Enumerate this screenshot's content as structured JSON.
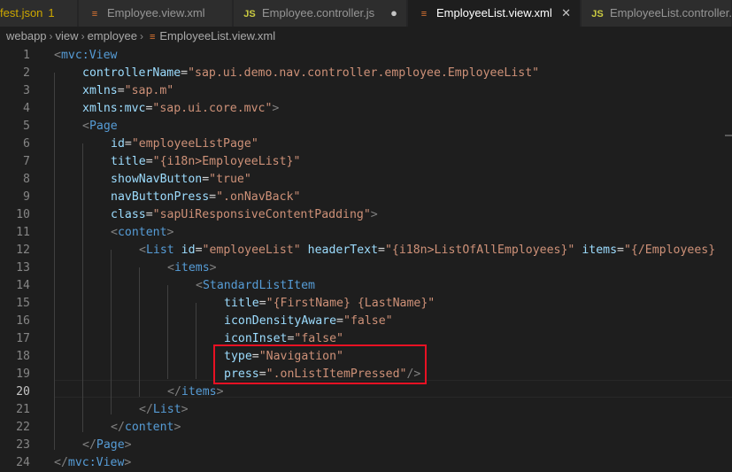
{
  "tabs": [
    {
      "label": "fest.json",
      "badge": "1",
      "icon": "json-icon",
      "state": "warning"
    },
    {
      "label": "Employee.view.xml",
      "icon": "xml-icon",
      "state": "normal"
    },
    {
      "label": "Employee.controller.js",
      "icon": "js-icon",
      "icon_text": "JS",
      "state": "modified"
    },
    {
      "label": "EmployeeList.view.xml",
      "icon": "xml-icon",
      "state": "active"
    },
    {
      "label": "EmployeeList.controller.js",
      "icon": "js-icon",
      "icon_text": "JS",
      "state": "normal"
    }
  ],
  "breadcrumb": [
    "webapp",
    "view",
    "employee",
    "EmployeeList.view.xml"
  ],
  "current_line": 20,
  "lines": [
    {
      "n": "1"
    },
    {
      "n": "2"
    },
    {
      "n": "3"
    },
    {
      "n": "4"
    },
    {
      "n": "5"
    },
    {
      "n": "6"
    },
    {
      "n": "7"
    },
    {
      "n": "8"
    },
    {
      "n": "9"
    },
    {
      "n": "10"
    },
    {
      "n": "11"
    },
    {
      "n": "12"
    },
    {
      "n": "13"
    },
    {
      "n": "14"
    },
    {
      "n": "15"
    },
    {
      "n": "16"
    },
    {
      "n": "17"
    },
    {
      "n": "18"
    },
    {
      "n": "19"
    },
    {
      "n": "20"
    },
    {
      "n": "21"
    },
    {
      "n": "22"
    },
    {
      "n": "23"
    },
    {
      "n": "24"
    }
  ],
  "code": {
    "l1": {
      "t": "mvc:View"
    },
    "l2": {
      "a": "controllerName",
      "v": "\"sap.ui.demo.nav.controller.employee.EmployeeList\""
    },
    "l3": {
      "a": "xmlns",
      "v": "\"sap.m\""
    },
    "l4": {
      "a": "xmlns:mvc",
      "v": "\"sap.ui.core.mvc\""
    },
    "l5": {
      "t": "Page"
    },
    "l6": {
      "a": "id",
      "v": "\"employeeListPage\""
    },
    "l7": {
      "a": "title",
      "v": "\"{i18n>EmployeeList}\""
    },
    "l8": {
      "a": "showNavButton",
      "v": "\"true\""
    },
    "l9": {
      "a": "navButtonPress",
      "v": "\".onNavBack\""
    },
    "l10": {
      "a": "class",
      "v": "\"sapUiResponsiveContentPadding\""
    },
    "l11": {
      "t": "content"
    },
    "l12": {
      "t": "List",
      "a1": "id",
      "v1": "\"employeeList\"",
      "a2": "headerText",
      "v2": "\"{i18n>ListOfAllEmployees}\"",
      "a3": "items",
      "v3": "\"{/Employees}"
    },
    "l13": {
      "t": "items"
    },
    "l14": {
      "t": "StandardListItem"
    },
    "l15": {
      "a": "title",
      "v": "\"{FirstName} {LastName}\""
    },
    "l16": {
      "a": "iconDensityAware",
      "v": "\"false\""
    },
    "l17": {
      "a": "iconInset",
      "v": "\"false\""
    },
    "l18": {
      "a": "type",
      "v": "\"Navigation\""
    },
    "l19": {
      "a": "press",
      "v": "\".onListItemPressed\""
    },
    "l20": {
      "t": "items"
    },
    "l21": {
      "t": "List"
    },
    "l22": {
      "t": "content"
    },
    "l23": {
      "t": "Page"
    },
    "l24": {
      "t": "mvc:View"
    }
  },
  "colors": {
    "tag": "#569cd6",
    "attribute": "#9cdcfe",
    "string": "#ce9178",
    "highlight": "#e81123"
  }
}
